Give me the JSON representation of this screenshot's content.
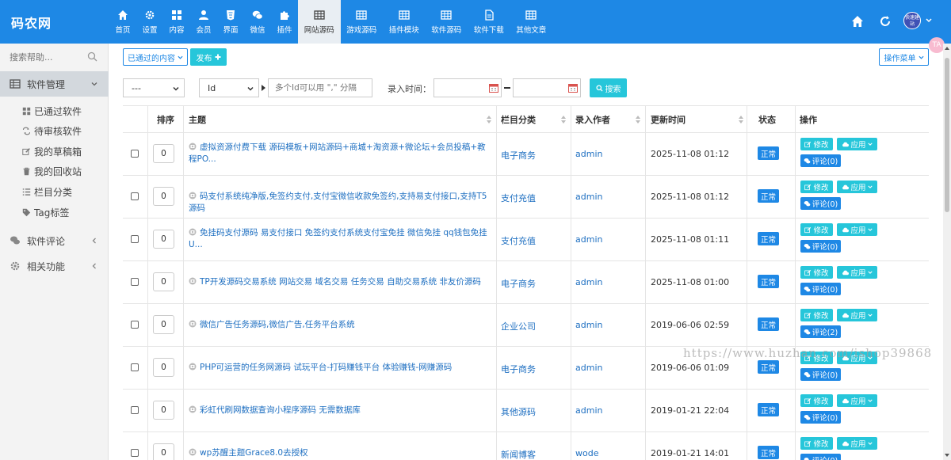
{
  "app": {
    "brand": "码农网"
  },
  "topnav": [
    {
      "label": "首页",
      "icon": "home-icon"
    },
    {
      "label": "设置",
      "icon": "gear-icon"
    },
    {
      "label": "内容",
      "icon": "grid-icon"
    },
    {
      "label": "会员",
      "icon": "user-icon"
    },
    {
      "label": "界面",
      "icon": "html5-icon"
    },
    {
      "label": "微信",
      "icon": "wechat-icon"
    },
    {
      "label": "插件",
      "icon": "puzzle-icon"
    },
    {
      "label": "网站源码",
      "icon": "table-icon",
      "active": true
    },
    {
      "label": "游戏源码",
      "icon": "table-icon"
    },
    {
      "label": "插件模块",
      "icon": "table-icon"
    },
    {
      "label": "软件源码",
      "icon": "table-icon"
    },
    {
      "label": "软件下载",
      "icon": "file-icon"
    },
    {
      "label": "其他文章",
      "icon": "table-icon"
    }
  ],
  "topright": {
    "logo_text": "快速建站"
  },
  "sidebar": {
    "search_placeholder": "搜索帮助...",
    "group_active": "软件管理",
    "subitems": [
      {
        "label": "已通过软件",
        "icon": "grid-icon"
      },
      {
        "label": "待审核软件",
        "icon": "retweet-icon"
      },
      {
        "label": "我的草稿箱",
        "icon": "edit-icon"
      },
      {
        "label": "我的回收站",
        "icon": "trash-icon"
      },
      {
        "label": "栏目分类",
        "icon": "list-icon"
      },
      {
        "label": "Tag标签",
        "icon": "tag-icon"
      }
    ],
    "groups": [
      {
        "label": "软件评论",
        "icon": "comments-icon"
      },
      {
        "label": "相关功能",
        "icon": "gear-icon"
      }
    ]
  },
  "toolbar": {
    "filter_label": "已通过的内容",
    "publish_label": "发布",
    "ops_menu_label": "操作菜单"
  },
  "search": {
    "select1_value": "---",
    "select2_value": "Id",
    "ids_placeholder": "多个Id可以用 \",\" 分隔",
    "time_label": "录入时间：",
    "search_button": "搜索"
  },
  "table": {
    "headers": {
      "order": "排序",
      "subject": "主题",
      "category": "栏目分类",
      "author": "录入作者",
      "updated": "更新时间",
      "status": "状态",
      "actions": "操作"
    },
    "edit_label": "修改",
    "apply_label": "应用",
    "rows": [
      {
        "order": "0",
        "title": "虚拟资源付费下载 源码模板+网站源码+商城+淘资源+微论坛+会员投稿+教程PO...",
        "category": "电子商务",
        "author": "admin",
        "time": "2025-11-08 01:12",
        "status": "正常",
        "comments": "评论(0)"
      },
      {
        "order": "0",
        "title": "码支付系统纯净版,免签约支付,支付宝微信收款免签约,支持易支付接口,支持T5源码",
        "category": "支付充值",
        "author": "admin",
        "time": "2025-11-08 01:12",
        "status": "正常",
        "comments": "评论(0)"
      },
      {
        "order": "0",
        "title": "免挂码支付源码 易支付接口 免签约支付系统支付宝免挂 微信免挂 qq钱包免挂U...",
        "category": "支付充值",
        "author": "admin",
        "time": "2025-11-08 01:11",
        "status": "正常",
        "comments": "评论(0)"
      },
      {
        "order": "0",
        "title": "TP开发源码交易系统 网站交易 域名交易 任务交易 自助交易系统 非友价源码",
        "category": "电子商务",
        "author": "admin",
        "time": "2025-11-08 01:00",
        "status": "正常",
        "comments": "评论(0)"
      },
      {
        "order": "0",
        "title": "微信广告任务源码,微信广告,任务平台系统",
        "category": "企业公司",
        "author": "admin",
        "time": "2019-06-06 02:59",
        "status": "正常",
        "comments": "评论(2)"
      },
      {
        "order": "0",
        "title": "PHP可运营的任务网源码 试玩平台-打码赚钱平台 体验赚钱-网赚源码",
        "category": "电子商务",
        "author": "admin",
        "time": "2019-06-06 01:09",
        "status": "正常",
        "comments": "评论(0)"
      },
      {
        "order": "0",
        "title": "彩虹代刷网数据查询小程序源码 无需数据库",
        "category": "其他源码",
        "author": "admin",
        "time": "2019-01-21 22:04",
        "status": "正常",
        "comments": "评论(0)"
      },
      {
        "order": "0",
        "title": "wp苏醒主题Grace8.0去授权",
        "category": "新闻博客",
        "author": "wode",
        "time": "2019-01-21 14:01",
        "status": "正常",
        "comments": "评论(0)"
      }
    ]
  },
  "watermark": "https://www.huzhan.com/ishop39868",
  "fab_label": "TA",
  "colors": {
    "primary": "#1e88e5",
    "teal": "#26c6da",
    "link": "#1e6fc1"
  }
}
